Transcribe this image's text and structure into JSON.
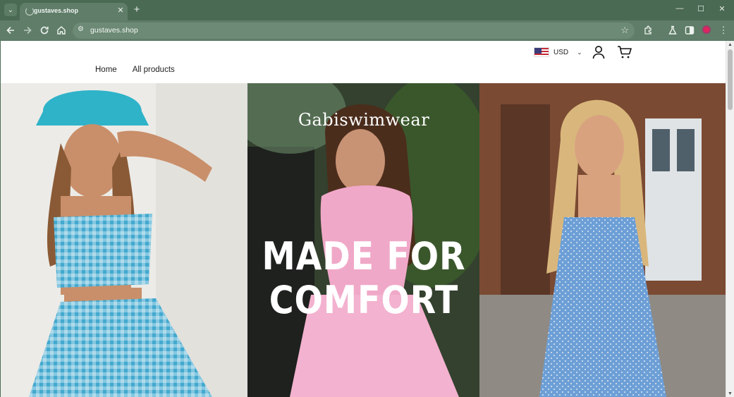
{
  "browser": {
    "tab_title": "gustaves.shop",
    "tab_close": "✕",
    "new_tab": "+",
    "url": "gustaves.shop",
    "controls": {
      "minimize": "—",
      "maximize": "☐",
      "close": "✕"
    },
    "icons": [
      "back-icon",
      "forward-icon",
      "reload-icon",
      "home-icon",
      "site-info-icon",
      "bookmark-star-icon",
      "extensions-icon",
      "labs-icon",
      "side-panel-icon",
      "profile-icon",
      "menu-icon"
    ]
  },
  "site": {
    "currency": {
      "code": "USD",
      "caret": "⌄"
    },
    "nav": [
      {
        "label": "Home"
      },
      {
        "label": "All products"
      }
    ]
  },
  "hero": {
    "brand": "Gabiswimwear",
    "headline_line1": "MADE FOR",
    "headline_line2": "COMFORT"
  },
  "colors": {
    "browser_frame": "#4f6e58",
    "toolbar": "#5f7d68",
    "page_bg": "#ffffff",
    "nav_text": "#1e1e1e",
    "headline": "#ffffff"
  }
}
